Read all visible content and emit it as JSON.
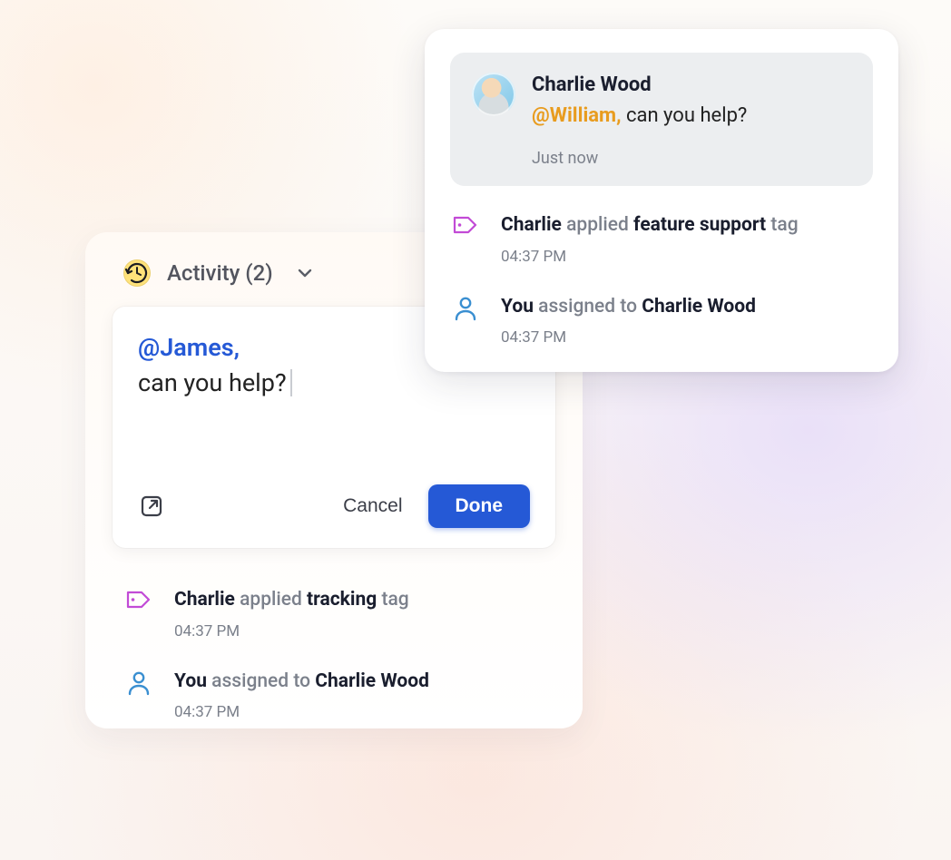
{
  "notification": {
    "author": "Charlie Wood",
    "mention": "@William,",
    "message_rest": " can you help?",
    "timestamp": "Just now",
    "activities": [
      {
        "icon": "tag",
        "actor": "Charlie",
        "verb": "applied",
        "object": "feature support",
        "suffix": "tag",
        "time": "04:37 PM"
      },
      {
        "icon": "user",
        "actor": "You",
        "verb": "assigned to",
        "object": "Charlie Wood",
        "suffix": "",
        "time": "04:37 PM"
      }
    ]
  },
  "panel": {
    "title": "Activity (2)",
    "compose": {
      "mention": "@James,",
      "rest": "can you help?",
      "cancel_label": "Cancel",
      "done_label": "Done"
    },
    "activities": [
      {
        "icon": "tag",
        "actor": "Charlie",
        "verb": "applied",
        "object": "tracking",
        "suffix": "tag",
        "time": "04:37 PM"
      },
      {
        "icon": "user",
        "actor": "You",
        "verb": "assigned to",
        "object": "Charlie Wood",
        "suffix": "",
        "time": "04:37 PM"
      }
    ]
  }
}
